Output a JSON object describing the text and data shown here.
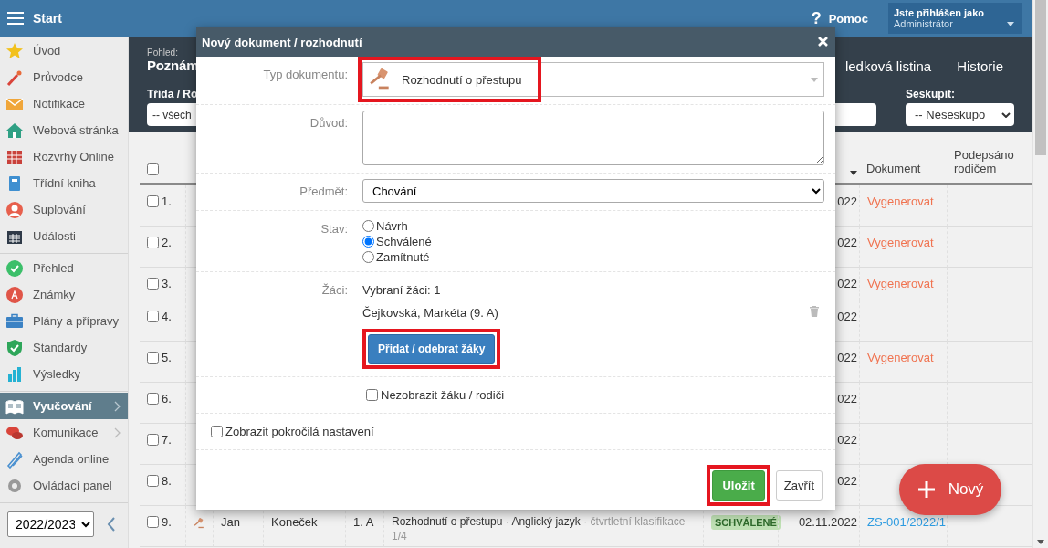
{
  "topbar": {
    "menu_label": "Start",
    "help_icon": "?",
    "help": "Pomoc",
    "user_caption": "Jste přihlášen jako",
    "user_role": "Administrátor"
  },
  "sidebar": {
    "groups": [
      [
        {
          "label": "Úvod",
          "selected": false,
          "expandable": false
        },
        {
          "label": "Průvodce",
          "selected": false,
          "expandable": false
        },
        {
          "label": "Notifikace",
          "selected": false,
          "expandable": false
        },
        {
          "label": "Webová stránka",
          "selected": false,
          "expandable": false
        },
        {
          "label": "Rozvrhy Online",
          "selected": false,
          "expandable": false
        },
        {
          "label": "Třídní kniha",
          "selected": false,
          "expandable": false
        },
        {
          "label": "Suplování",
          "selected": false,
          "expandable": false
        },
        {
          "label": "Události",
          "selected": false,
          "expandable": false
        }
      ],
      [
        {
          "label": "Přehled",
          "selected": false,
          "expandable": false
        },
        {
          "label": "Známky",
          "selected": false,
          "expandable": false
        },
        {
          "label": "Plány a přípravy",
          "selected": false,
          "expandable": false
        },
        {
          "label": "Standardy",
          "selected": false,
          "expandable": false
        },
        {
          "label": "Výsledky",
          "selected": false,
          "expandable": false
        }
      ],
      [
        {
          "label": "Vyučování",
          "selected": true,
          "expandable": true
        },
        {
          "label": "Komunikace",
          "selected": false,
          "expandable": true
        },
        {
          "label": "Agenda online",
          "selected": false,
          "expandable": false
        },
        {
          "label": "Ovládací panel",
          "selected": false,
          "expandable": false
        }
      ]
    ],
    "year": "2022/2023"
  },
  "header": {
    "view_label": "Pohled:",
    "view_title": "Poznám",
    "tabs": [
      {
        "label": "ledková listina",
        "selected": false
      },
      {
        "label": "Historie",
        "selected": false
      }
    ],
    "class_label": "Třída / Ro",
    "class_value": "-- všech",
    "group_label": "Seskupit:",
    "group_value": "-- Neseskupo"
  },
  "table": {
    "all_checked": false,
    "columns": [
      {
        "label": "Dokument"
      },
      {
        "label": "Podepsáno rodičem"
      }
    ],
    "rows": [
      {
        "number": "1.",
        "checked": false,
        "date": "022",
        "document": {
          "label": "Vygenerovat",
          "kind": "action"
        }
      },
      {
        "number": "2.",
        "checked": false,
        "date": "022",
        "document": {
          "label": "Vygenerovat",
          "kind": "action"
        }
      },
      {
        "number": "3.",
        "checked": false,
        "date": "022",
        "document": {
          "label": "Vygenerovat",
          "kind": "action"
        }
      },
      {
        "number": "4.",
        "checked": false,
        "date": "022"
      },
      {
        "number": "5.",
        "checked": false,
        "date": "022",
        "document": {
          "label": "Vygenerovat",
          "kind": "action"
        }
      },
      {
        "number": "6.",
        "checked": false,
        "date": "022"
      },
      {
        "number": "7.",
        "checked": false,
        "date": "022"
      },
      {
        "number": "8.",
        "checked": false,
        "date": "022"
      },
      {
        "number": "9.",
        "checked": false,
        "first_name": "Jan",
        "last_name": "Koneček",
        "class": "1. A",
        "description": "Rozhodnutí o přestupu · Anglický jazyk",
        "description_note": "· čtvrtletní klasifikace",
        "count": "1/4",
        "status": "SCHVÁLENÉ",
        "date": "02.11.2022",
        "document": {
          "label": "ZS-001/2022/1",
          "kind": "link"
        }
      }
    ]
  },
  "modal": {
    "title": "Nový dokument / rozhodnutí",
    "fields": [
      {
        "kind": "type",
        "label": "Typ dokumentu:",
        "value": "Rozhodnutí o přestupu",
        "highlighted": true
      },
      {
        "kind": "textarea",
        "label": "Důvod:"
      },
      {
        "kind": "select",
        "label": "Předmět:",
        "value": "Chování"
      },
      {
        "kind": "radios",
        "label": "Stav:",
        "options": [
          {
            "label": "Návrh",
            "selected": false
          },
          {
            "label": "Schválené",
            "selected": true
          },
          {
            "label": "Zamítnuté",
            "selected": false
          }
        ]
      },
      {
        "kind": "students",
        "label": "Žáci:",
        "summary": "Vybraní žáci: 1",
        "students": [
          "Čejkovská, Markéta (9. A)"
        ],
        "button": "Přidat / odebrat žáky",
        "highlighted": true
      },
      {
        "kind": "checkbox",
        "label": "Nezobrazit žáku / rodiči",
        "checked": false,
        "indented": true
      },
      {
        "kind": "checkbox",
        "label": "Zobrazit pokročilá nastavení",
        "checked": false,
        "indented": false
      }
    ],
    "buttons": [
      {
        "label": "Uložit",
        "kind": "primary",
        "highlighted": true
      },
      {
        "label": "Zavřít",
        "kind": "default",
        "highlighted": false
      }
    ]
  },
  "fab": "Nový"
}
